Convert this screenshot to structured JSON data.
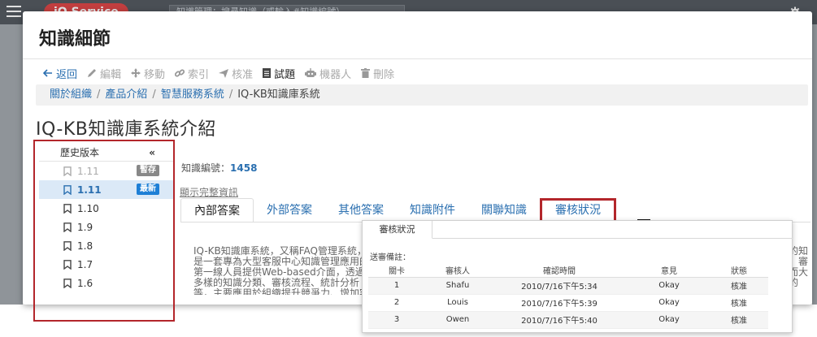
{
  "app": {
    "brand": "iQ Service",
    "search_placeholder": "知識管理：搜尋知識（或輸入#知識編號）"
  },
  "modal": {
    "title": "知識細節"
  },
  "toolbar": {
    "back": "返回",
    "edit": "編輯",
    "move": "移動",
    "index": "索引",
    "publish": "核准",
    "quiz": "試題",
    "robot": "機器人",
    "delete": "刪除"
  },
  "breadcrumb": {
    "items": [
      "關於組織",
      "產品介紹",
      "智慧服務系統"
    ],
    "current": "IQ-KB知識庫系統"
  },
  "document": {
    "title": "IQ-KB知識庫系統介紹",
    "id_label": "知識編號：",
    "id_value": "1458",
    "full_info_link": "顯示完整資訊",
    "answer_left": "IQ-KB知識庫系統，又稱FAQ管理系統，是一套專為大型客服中心知識管理應用的第一線人員提供Web-based介面，透過多樣的知識分類、審核流程、統計分析等，主要應用於組織提升競爭力、增加客戶滿意度。",
    "answer_right": "式的知識、審核而大幅的"
  },
  "history": {
    "header": "歷史版本",
    "collapse_icon": "«",
    "versions": [
      {
        "label": "1.11",
        "badge": "暫存"
      },
      {
        "label": "1.11",
        "badge": "最新"
      },
      {
        "label": "1.10",
        "badge": ""
      },
      {
        "label": "1.9",
        "badge": ""
      },
      {
        "label": "1.8",
        "badge": ""
      },
      {
        "label": "1.7",
        "badge": ""
      },
      {
        "label": "1.6",
        "badge": ""
      }
    ]
  },
  "tabs": [
    "內部答案",
    "外部答案",
    "其他答案",
    "知識附件",
    "關聯知識",
    "審核狀況"
  ],
  "review": {
    "tab_label": "審核狀況",
    "note_label": "送審備註：",
    "columns": [
      "關卡",
      "審核人",
      "確認時間",
      "意見",
      "狀態"
    ],
    "rows": [
      [
        "1",
        "Shafu",
        "2010/7/16下午5:34",
        "Okay",
        "核准"
      ],
      [
        "2",
        "Louis",
        "2010/7/16下午5:39",
        "Okay",
        "核准"
      ],
      [
        "3",
        "Owen",
        "2010/7/16下午5:40",
        "Okay",
        "核准"
      ]
    ]
  },
  "colors": {
    "accent": "#2a6fb0",
    "highlight_box": "#b3262b",
    "brand": "#d83c3c",
    "topbar": "#4a4f55"
  }
}
